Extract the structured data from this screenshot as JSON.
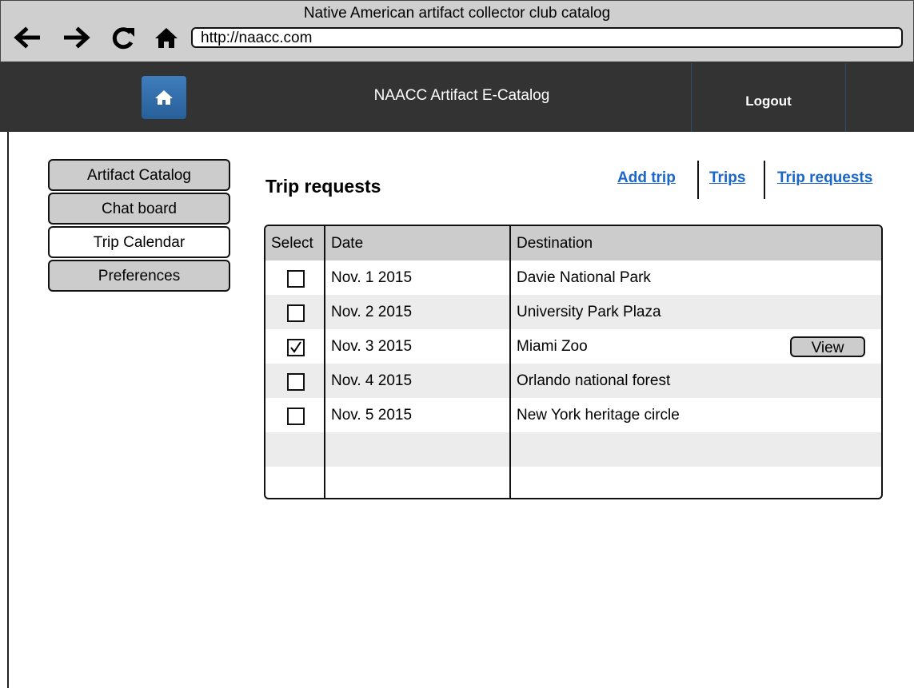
{
  "window": {
    "title": "Native American artifact collector club catalog"
  },
  "browser": {
    "url": "http://naacc.com"
  },
  "header": {
    "title": "NAACC Artifact E-Catalog",
    "logout_label": "Logout"
  },
  "sidebar": {
    "items": [
      {
        "label": "Artifact Catalog",
        "active": false
      },
      {
        "label": "Chat board",
        "active": false
      },
      {
        "label": "Trip Calendar",
        "active": true
      },
      {
        "label": "Preferences",
        "active": false
      }
    ]
  },
  "main": {
    "title": "Trip requests",
    "links": [
      "Add trip",
      "Trips",
      "Trip requests"
    ],
    "table": {
      "headers": [
        "Select",
        "Date",
        "Destination"
      ],
      "rows": [
        {
          "checked": false,
          "date": "Nov. 1 2015",
          "destination": "Davie National Park"
        },
        {
          "checked": false,
          "date": "Nov. 2 2015",
          "destination": "University Park Plaza"
        },
        {
          "checked": true,
          "date": "Nov. 3 2015",
          "destination": "Miami Zoo"
        },
        {
          "checked": false,
          "date": "Nov. 4 2015",
          "destination": "Orlando national forest"
        },
        {
          "checked": false,
          "date": "Nov. 5 2015",
          "destination": "New York heritage circle"
        }
      ],
      "view_label": "View"
    }
  }
}
